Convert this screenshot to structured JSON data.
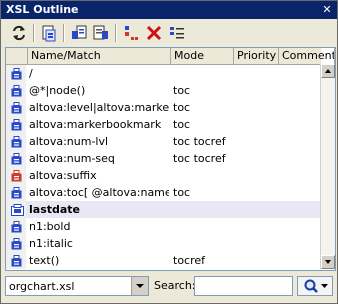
{
  "window": {
    "title": "XSL Outline",
    "close_glyph": "✕"
  },
  "toolbar": {
    "buttons": [
      {
        "icon": "sync-icon"
      },
      {
        "icon": "new-template-icon"
      },
      {
        "icon": "assign-icon"
      },
      {
        "icon": "goto-icon"
      },
      {
        "icon": "sort-icon"
      },
      {
        "icon": "delete-icon"
      },
      {
        "icon": "list-options-icon"
      }
    ]
  },
  "table": {
    "columns": [
      "Name/Match",
      "Mode",
      "Priority",
      "Comment"
    ],
    "rows": [
      {
        "name": "/",
        "mode": "",
        "icon": "template-icon",
        "color": "#2a49c8"
      },
      {
        "name": "@*|node()",
        "mode": "toc",
        "icon": "template-icon",
        "color": "#2a49c8"
      },
      {
        "name": "altova:level|altova:marker|altova",
        "mode": "toc",
        "icon": "template-icon",
        "color": "#2a49c8"
      },
      {
        "name": "altova:markerbookmark",
        "mode": "toc",
        "icon": "template-icon",
        "color": "#2a49c8"
      },
      {
        "name": "altova:num-lvl",
        "mode": "toc tocref",
        "icon": "template-icon",
        "color": "#2a49c8"
      },
      {
        "name": "altova:num-seq",
        "mode": "toc tocref",
        "icon": "template-icon",
        "color": "#2a49c8"
      },
      {
        "name": "altova:suffix",
        "mode": "",
        "icon": "template-icon",
        "color": "#c83a2a"
      },
      {
        "name": "altova:toc[ @altova:name = 'l",
        "mode": "toc",
        "icon": "template-icon",
        "color": "#2a49c8"
      },
      {
        "name": "lastdate",
        "mode": "",
        "icon": "named-template-icon",
        "color": "#2a49c8",
        "selected": true
      },
      {
        "name": "n1:bold",
        "mode": "",
        "icon": "template-icon",
        "color": "#2a49c8"
      },
      {
        "name": "n1:italic",
        "mode": "",
        "icon": "template-icon",
        "color": "#2a49c8"
      },
      {
        "name": "text()",
        "mode": "tocref",
        "icon": "template-icon",
        "color": "#2a49c8"
      }
    ]
  },
  "bottom": {
    "file_value": "orgchart.xsl",
    "search_label": "Search:",
    "search_value": ""
  },
  "colors": {
    "title_bg": "#0a246a",
    "accent": "#2a49c8",
    "red": "#c83a2a"
  }
}
